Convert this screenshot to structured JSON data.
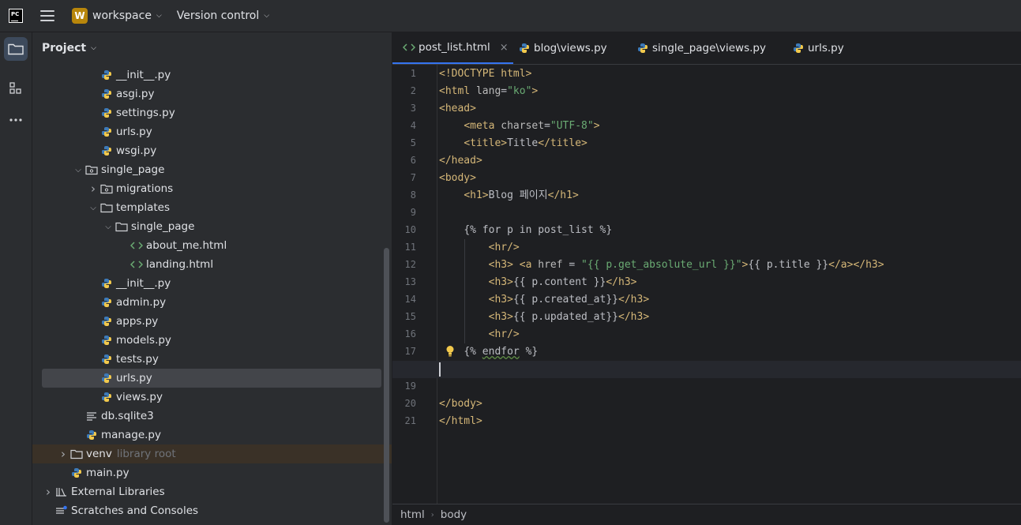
{
  "titlebar": {
    "logo_text": "PC",
    "project_badge": "W",
    "project_name": "workspace",
    "vcs_label": "Version control"
  },
  "toolstrip": {
    "items": [
      "folder-icon",
      "structure-icon",
      "more-icon"
    ]
  },
  "project_panel": {
    "title": "Project",
    "tree": [
      {
        "label": "__init__.py",
        "icon": "python-file-icon"
      },
      {
        "label": "asgi.py",
        "icon": "python-file-icon"
      },
      {
        "label": "settings.py",
        "icon": "python-file-icon"
      },
      {
        "label": "urls.py",
        "icon": "python-file-icon"
      },
      {
        "label": "wsgi.py",
        "icon": "python-file-icon"
      },
      {
        "label": "single_page",
        "icon": "package-folder-icon",
        "expanded": true
      },
      {
        "label": "migrations",
        "icon": "package-folder-icon",
        "expanded": false
      },
      {
        "label": "templates",
        "icon": "folder-icon",
        "expanded": true
      },
      {
        "label": "single_page",
        "icon": "folder-icon",
        "expanded": true
      },
      {
        "label": "about_me.html",
        "icon": "html-file-icon"
      },
      {
        "label": "landing.html",
        "icon": "html-file-icon"
      },
      {
        "label": "__init__.py",
        "icon": "python-file-icon"
      },
      {
        "label": "admin.py",
        "icon": "python-file-icon"
      },
      {
        "label": "apps.py",
        "icon": "python-file-icon"
      },
      {
        "label": "models.py",
        "icon": "python-file-icon"
      },
      {
        "label": "tests.py",
        "icon": "python-file-icon"
      },
      {
        "label": "urls.py",
        "icon": "python-file-icon",
        "selected": true
      },
      {
        "label": "views.py",
        "icon": "python-file-icon"
      },
      {
        "label": "db.sqlite3",
        "icon": "text-file-icon"
      },
      {
        "label": "manage.py",
        "icon": "python-file-icon"
      },
      {
        "label": "venv",
        "icon": "folder-icon",
        "hint": "library root",
        "expanded": false
      },
      {
        "label": "main.py",
        "icon": "python-file-icon"
      },
      {
        "label": "External Libraries",
        "icon": "library-icon",
        "expanded": false
      },
      {
        "label": "Scratches and Consoles",
        "icon": "scratches-icon"
      }
    ]
  },
  "editor": {
    "tabs": [
      {
        "label": "post_list.html",
        "icon": "html-file-icon",
        "active": true,
        "close": "×"
      },
      {
        "label": "blog\\views.py",
        "icon": "python-file-icon"
      },
      {
        "label": "single_page\\views.py",
        "icon": "python-file-icon"
      },
      {
        "label": "urls.py",
        "icon": "python-file-icon"
      }
    ],
    "current_line": 18,
    "lines": [
      "<!DOCTYPE html>",
      "<html lang=\"ko\">",
      "<head>",
      "    <meta charset=\"UTF-8\">",
      "    <title>Title</title>",
      "</head>",
      "<body>",
      "    <h1>Blog 페이지</h1>",
      "",
      "    {% for p in post_list %}",
      "        <hr/>",
      "        <h3> <a href = \"{{ p.get_absolute_url }}\">{{ p.title }}</a></h3>",
      "        <h3>{{ p.content }}</h3>",
      "        <h3>{{ p.created_at}}</h3>",
      "        <h3>{{ p.updated_at}}</h3>",
      "        <hr/>",
      "    {% endfor %}",
      "",
      "",
      "</body>",
      "</html>"
    ],
    "breadcrumb": [
      "html",
      "body"
    ],
    "breadcrumb_sep": "›"
  },
  "colors": {
    "accent": "#3574f0",
    "tag": "#d5b778",
    "string": "#6aab73",
    "python_blue": "#3d7ab8",
    "python_yellow": "#f2c94c"
  }
}
